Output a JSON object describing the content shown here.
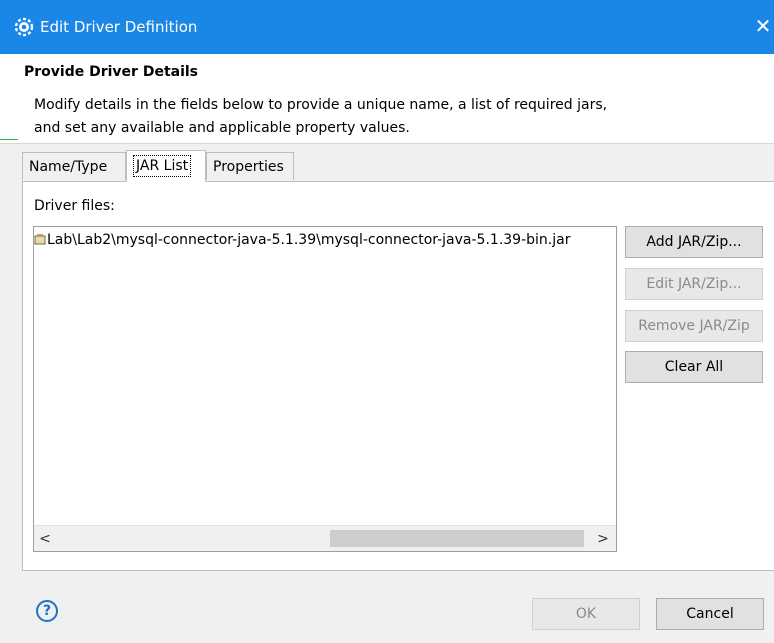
{
  "window": {
    "title": "Edit Driver Definition",
    "close_glyph": "✕",
    "icon": "gear-icon"
  },
  "header": {
    "heading": "Provide Driver Details",
    "description_line1": "Modify details in the fields below to provide a unique name, a list of required jars,",
    "description_line2": "and set any available and applicable property values."
  },
  "tabs": [
    {
      "label": "Name/Type",
      "active": false
    },
    {
      "label": "JAR List",
      "active": true
    },
    {
      "label": "Properties",
      "active": false
    }
  ],
  "jar_list": {
    "label": "Driver files:",
    "files": [
      "Lab\\Lab2\\mysql-connector-java-5.1.39\\mysql-connector-java-5.1.39-bin.jar"
    ],
    "scroll_left": "<",
    "scroll_right": ">"
  },
  "side_buttons": {
    "add": "Add JAR/Zip...",
    "edit": "Edit JAR/Zip...",
    "remove": "Remove JAR/Zip",
    "clear": "Clear All"
  },
  "footer": {
    "help": "?",
    "ok": "OK",
    "cancel": "Cancel"
  },
  "colors": {
    "titlebar": "#1a86e6",
    "accent_line": "#32b24a",
    "help_blue": "#1b75c4"
  }
}
